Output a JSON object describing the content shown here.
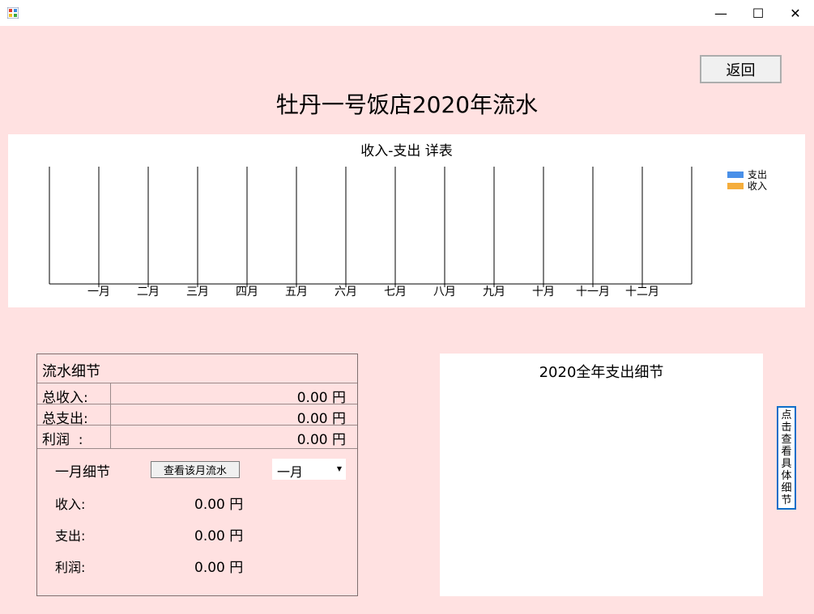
{
  "window": {
    "minimize_glyph": "—",
    "maximize_glyph": "☐",
    "close_glyph": "✕"
  },
  "header": {
    "back_label": "返回",
    "title": "牡丹一号饭店2020年流水"
  },
  "chart_data": {
    "type": "bar",
    "title": "收入-支出 详表",
    "categories": [
      "一月",
      "二月",
      "三月",
      "四月",
      "五月",
      "六月",
      "七月",
      "八月",
      "九月",
      "十月",
      "十一月",
      "十二月"
    ],
    "series": [
      {
        "name": "支出",
        "color": "#4a90e8",
        "values": [
          0,
          0,
          0,
          0,
          0,
          0,
          0,
          0,
          0,
          0,
          0,
          0
        ]
      },
      {
        "name": "收入",
        "color": "#f5ad3c",
        "values": [
          0,
          0,
          0,
          0,
          0,
          0,
          0,
          0,
          0,
          0,
          0,
          0
        ]
      }
    ],
    "legend_position": "top-right",
    "grid": true
  },
  "detail": {
    "header": "流水细节",
    "rows": [
      {
        "label": "总收入:",
        "value": "0.00 円"
      },
      {
        "label": "总支出:",
        "value": "0.00 円"
      },
      {
        "label": "利润  :",
        "value": "0.00 円"
      }
    ],
    "month_title": "一月细节",
    "view_month_button": "查看该月流水",
    "month_select_value": "一月",
    "stats": [
      {
        "label": "收入:",
        "value": "0.00 円"
      },
      {
        "label": "支出:",
        "value": "0.00 円"
      },
      {
        "label": "利润:",
        "value": "0.00 円"
      }
    ]
  },
  "expense": {
    "title": "2020全年支出细节"
  },
  "side_button": {
    "label": "点击查看具体细节"
  }
}
